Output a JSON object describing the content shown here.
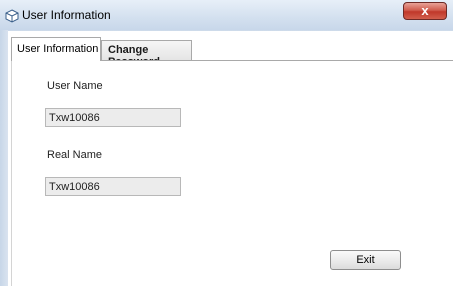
{
  "window": {
    "title": "User Information",
    "close_label": "x"
  },
  "tabs": [
    {
      "label": "User Information",
      "active": true
    },
    {
      "label": "Change Password",
      "active": false
    }
  ],
  "form": {
    "user_name_label": "User Name",
    "user_name_value": "Txw10086",
    "real_name_label": "Real Name",
    "real_name_value": "Txw10086"
  },
  "actions": {
    "exit_label": "Exit"
  },
  "icons": {
    "title_icon": "cube-icon",
    "close_icon": "close-icon"
  }
}
